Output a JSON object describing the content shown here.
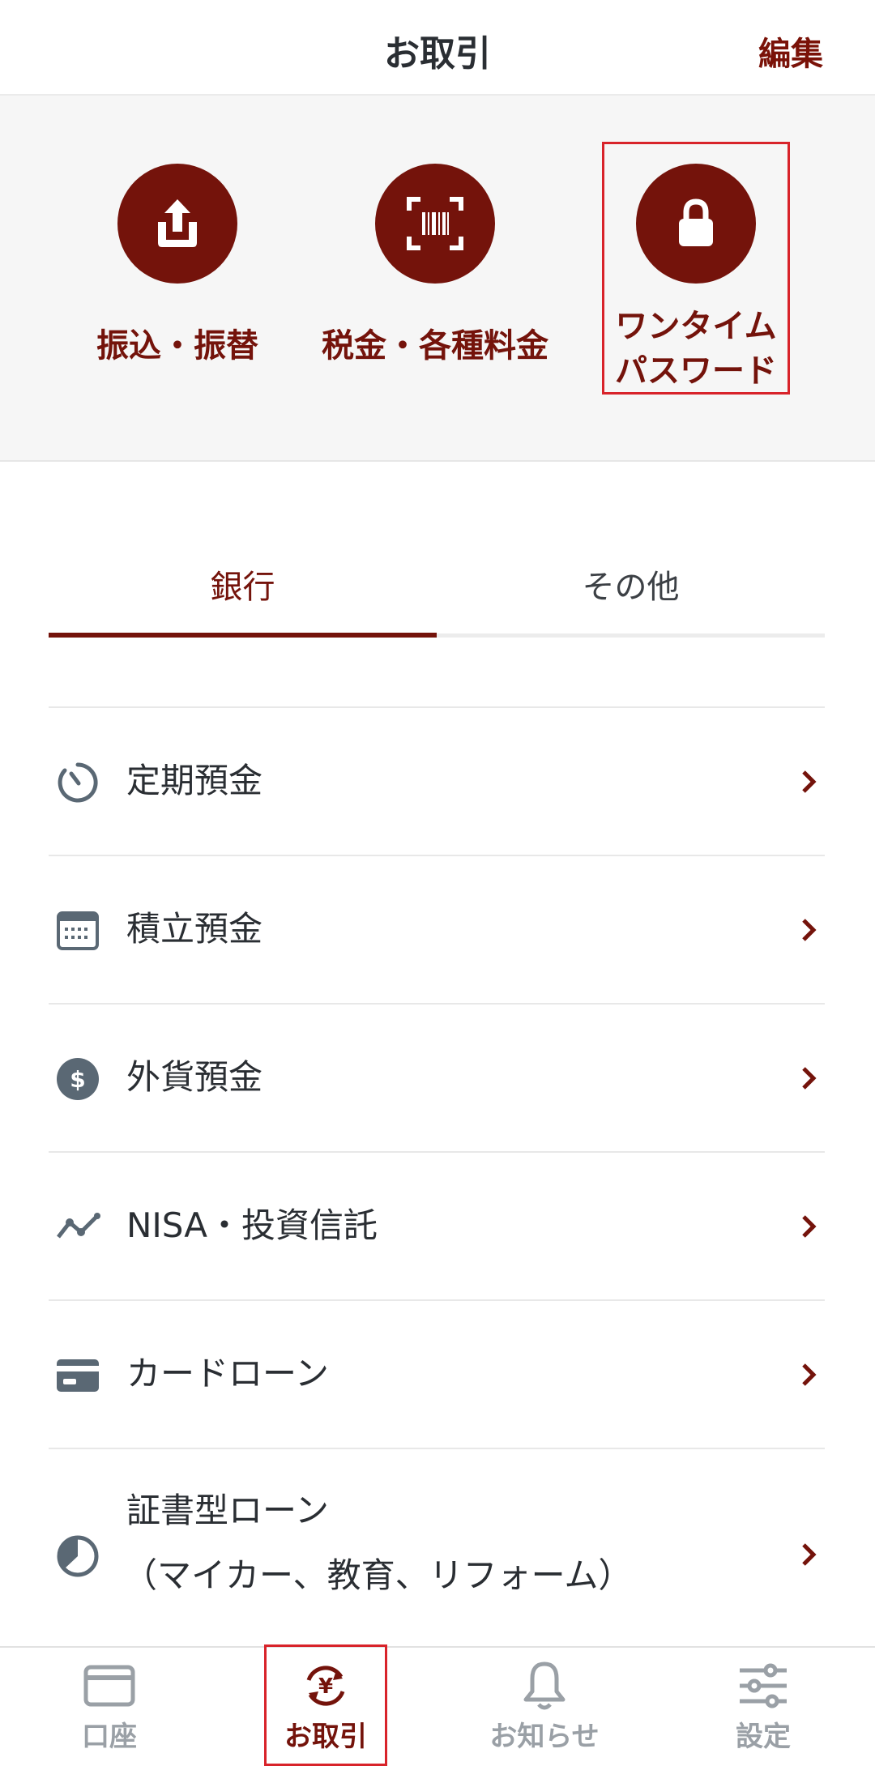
{
  "header": {
    "title": "お取引",
    "edit_label": "編集"
  },
  "quick_actions": [
    {
      "label": "振込・振替",
      "icon": "upload-icon"
    },
    {
      "label": "税金・各種料金",
      "icon": "barcode-scan-icon"
    },
    {
      "label_line1": "ワンタイム",
      "label_line2": "パスワード",
      "icon": "lock-icon"
    }
  ],
  "tabs": [
    {
      "label": "銀行",
      "active": true
    },
    {
      "label": "その他",
      "active": false
    }
  ],
  "menu_items": [
    {
      "label": "定期預金",
      "icon": "timer-icon"
    },
    {
      "label": "積立預金",
      "icon": "calendar-icon"
    },
    {
      "label": "外貨預金",
      "icon": "dollar-coin-icon"
    },
    {
      "label": "NISA・投資信託",
      "icon": "trend-line-icon"
    },
    {
      "label": "カードローン",
      "icon": "credit-card-icon"
    },
    {
      "label_line1": "証書型ローン",
      "label_line2": "（マイカー、教育、リフォーム）",
      "icon": "pie-half-icon"
    }
  ],
  "bottom_nav": [
    {
      "label": "口座",
      "icon": "card-icon",
      "active": false
    },
    {
      "label": "お取引",
      "icon": "yen-exchange-icon",
      "active": true
    },
    {
      "label": "お知らせ",
      "icon": "bell-icon",
      "active": false
    },
    {
      "label": "設定",
      "icon": "sliders-icon",
      "active": false
    }
  ],
  "colors": {
    "accent": "#74130b",
    "highlight": "#d8232a",
    "icon_gray": "#5a6874",
    "inactive_nav": "#9aa0a6"
  }
}
